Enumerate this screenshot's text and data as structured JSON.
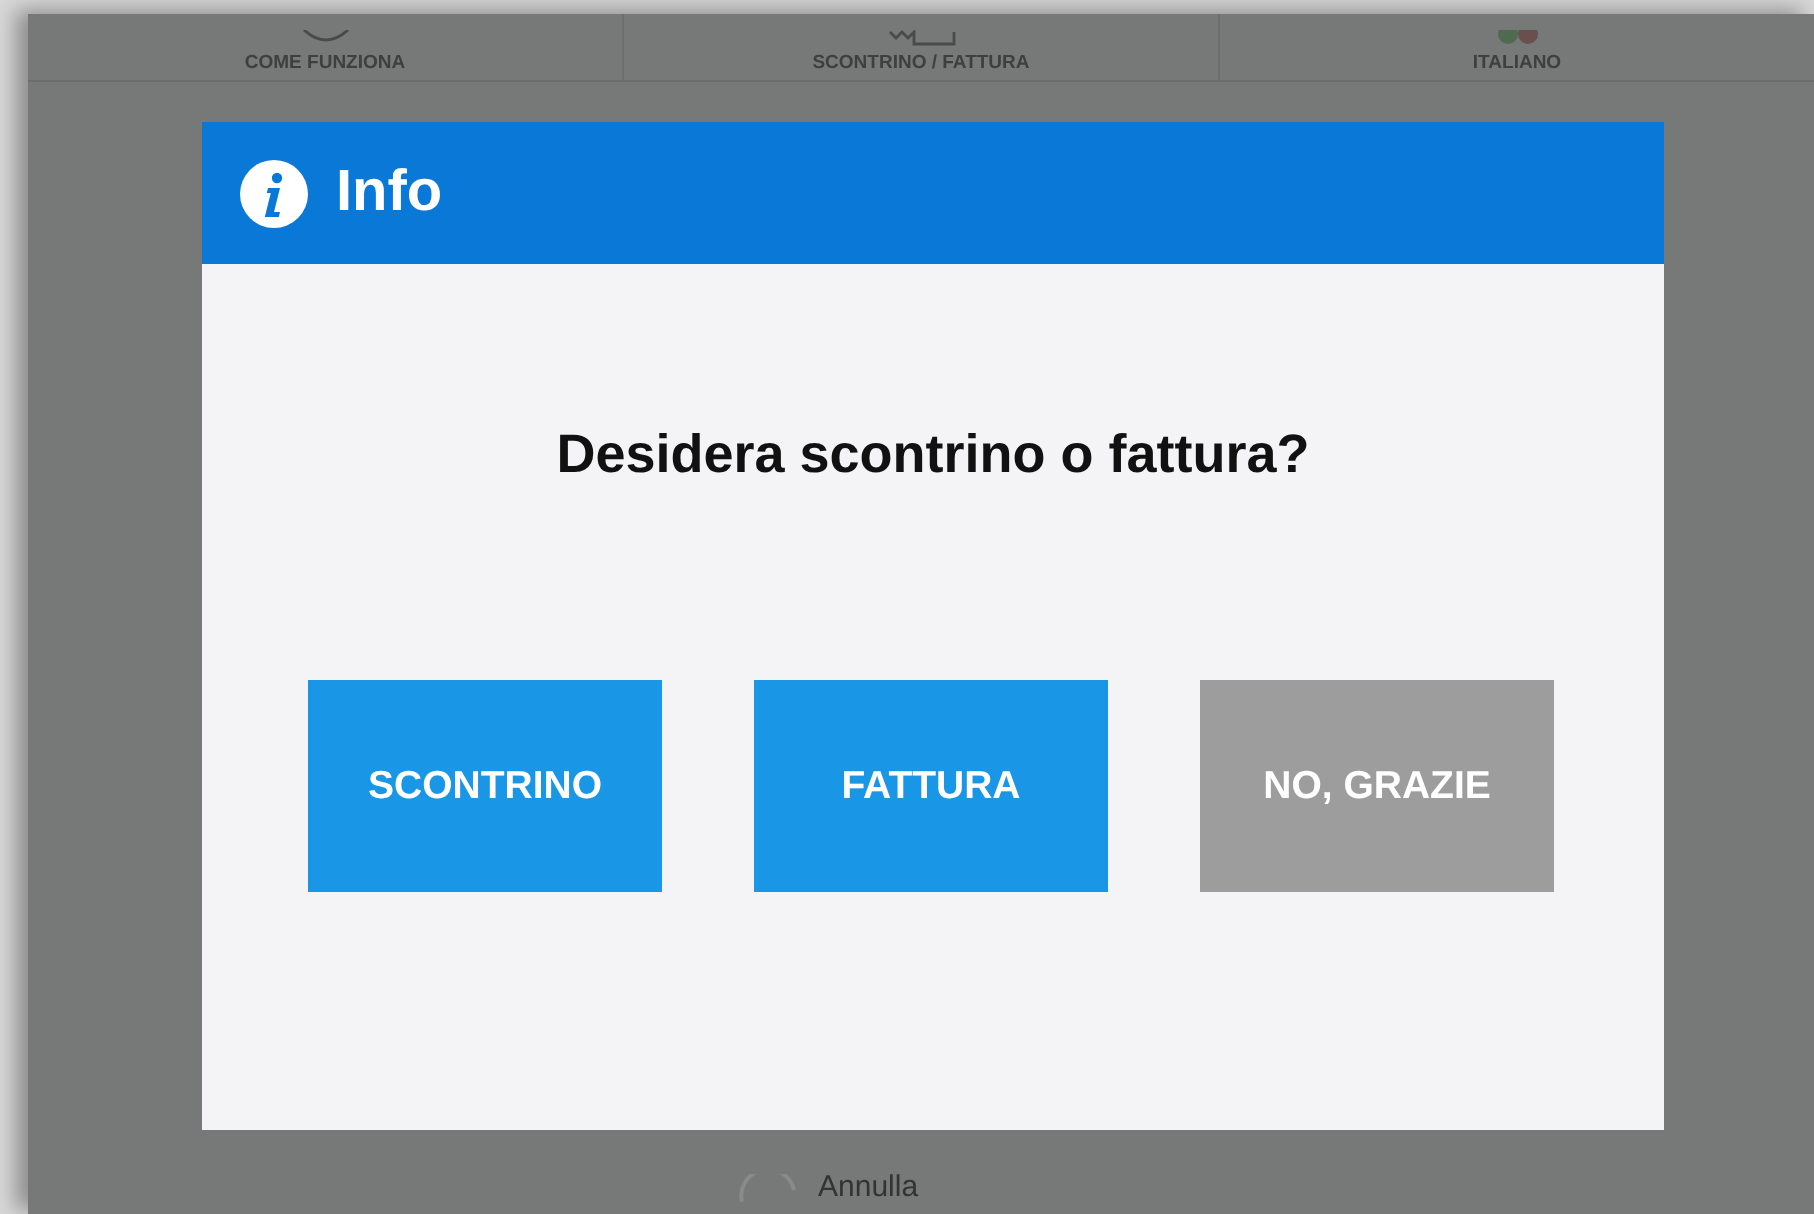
{
  "nav": {
    "items": [
      {
        "label": "COME FUNZIONA",
        "kind": "help"
      },
      {
        "label": "SCONTRINO / FATTURA",
        "kind": "receipt"
      },
      {
        "label": "ITALIANO",
        "kind": "language"
      }
    ]
  },
  "dialog": {
    "title": "Info",
    "question": "Desidera scontrino o fattura?",
    "buttons": [
      {
        "label": "SCONTRINO",
        "kind": "primary"
      },
      {
        "label": "FATTURA",
        "kind": "primary"
      },
      {
        "label": "NO, GRAZIE",
        "kind": "secondary"
      }
    ]
  },
  "footer": {
    "cancel": "Annulla"
  }
}
